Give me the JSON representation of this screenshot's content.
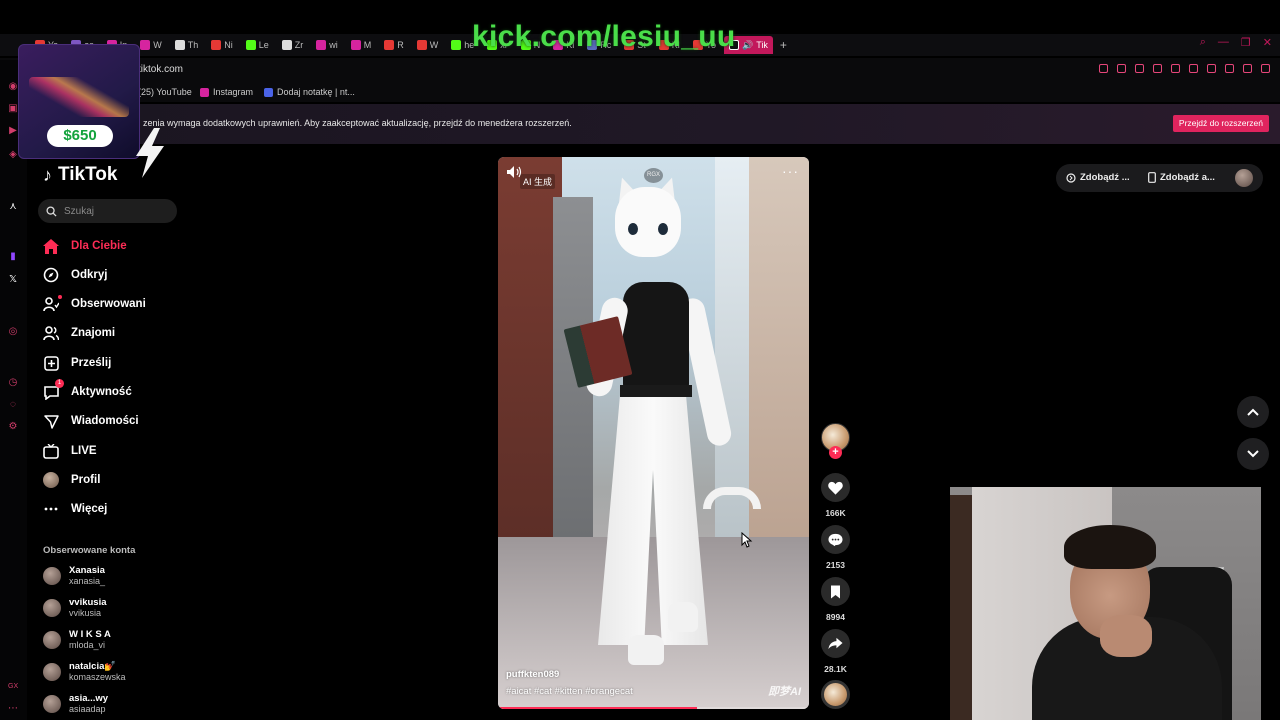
{
  "overlay": {
    "kick_banner": "kick.com/lesiu_uu",
    "donation_amount": "$650"
  },
  "browser": {
    "tabs": [
      {
        "label": "Yo",
        "color": "#e53935"
      },
      {
        "label": "as",
        "color": "#7e57c2"
      },
      {
        "label": "In",
        "color": "#d6249f"
      },
      {
        "label": "W",
        "color": "#d6249f"
      },
      {
        "label": "Th",
        "color": "#dddddd"
      },
      {
        "label": "Ni",
        "color": "#e53935"
      },
      {
        "label": "Le",
        "color": "#53fc18"
      },
      {
        "label": "Zr",
        "color": "#dddddd"
      },
      {
        "label": "wi",
        "color": "#d6249f"
      },
      {
        "label": "M",
        "color": "#d6249f"
      },
      {
        "label": "R",
        "color": "#e53935"
      },
      {
        "label": "W",
        "color": "#e53935"
      },
      {
        "label": "he",
        "color": "#53fc18"
      },
      {
        "label": "xr",
        "color": "#53fc18"
      },
      {
        "label": "N",
        "color": "#53fc18"
      },
      {
        "label": "Kl",
        "color": "#d6249f"
      },
      {
        "label": "Rc",
        "color": "#5c6bc0"
      },
      {
        "label": "St",
        "color": "#e53935"
      },
      {
        "label": "Kl",
        "color": "#e53935"
      },
      {
        "label": "Yo",
        "color": "#e53935"
      }
    ],
    "active_tab": "Tik",
    "new_tab": "+",
    "url": "tiktok.com",
    "bookmarks": [
      {
        "label": "(25) YouTube",
        "color": "#e53935"
      },
      {
        "label": "Instagram",
        "color": "#d6249f"
      },
      {
        "label": "Dodaj notatkę | nt...",
        "color": "#4a63e7"
      }
    ],
    "notice_text": "zenia wymaga dodatkowych uprawnień. Aby zaakceptować aktualizację, przejdź do menedżera rozszerzeń.",
    "notice_button": "Przejdź do rozszerzeń"
  },
  "tiktok": {
    "logo": "TikTok",
    "search_placeholder": "Szukaj",
    "nav": [
      {
        "label": "Dla Ciebie",
        "icon": "home-icon"
      },
      {
        "label": "Odkryj",
        "icon": "compass-icon"
      },
      {
        "label": "Obserwowani",
        "icon": "following-icon"
      },
      {
        "label": "Znajomi",
        "icon": "friends-icon"
      },
      {
        "label": "Prześlij",
        "icon": "upload-icon"
      },
      {
        "label": "Aktywność",
        "icon": "activity-icon",
        "badge": "1"
      },
      {
        "label": "Wiadomości",
        "icon": "messages-icon"
      },
      {
        "label": "LIVE",
        "icon": "live-icon"
      },
      {
        "label": "Profil",
        "icon": "profile-avatar"
      },
      {
        "label": "Więcej",
        "icon": "more-icon"
      }
    ],
    "followed_heading": "Obserwowane konta",
    "followed_accounts": [
      {
        "name": "Xanasia",
        "handle": "xanasia_"
      },
      {
        "name": "vvikusia",
        "handle": "vvikusia"
      },
      {
        "name": "W I K S A",
        "handle": "mloda_vi"
      },
      {
        "name": "natalcia💅",
        "handle": "komaszewska"
      },
      {
        "name": "asia...wy",
        "handle": "asiaadap"
      }
    ],
    "video": {
      "ai_label": "AI 生成",
      "watermark_top": "RGX",
      "author": "puffkten089",
      "tags": "#aicat #cat #kitten #orangecat",
      "brand": "即梦AI",
      "progress": 0.64
    },
    "actions": {
      "likes": "166K",
      "comments": "2153",
      "saves": "8994",
      "shares": "28.1K"
    },
    "topright": {
      "get_coins": "Zdobądź ...",
      "get_app": "Zdobądź a..."
    }
  }
}
